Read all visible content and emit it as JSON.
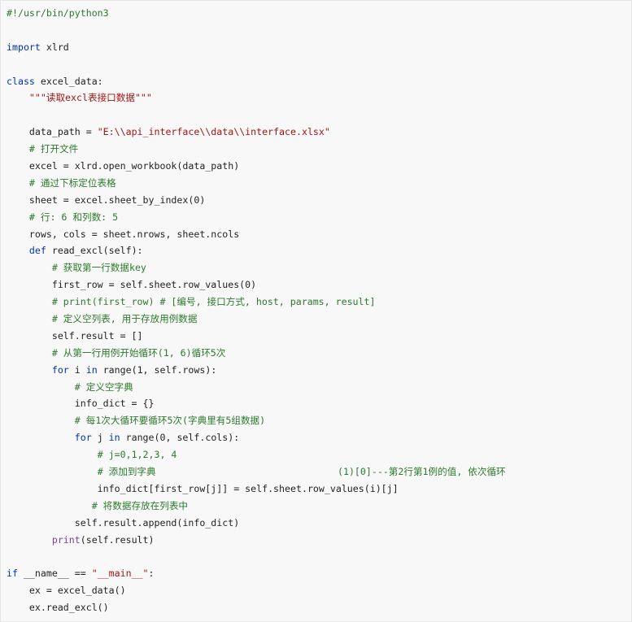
{
  "code_lines": [
    [
      {
        "t": "#!/usr/bin/python3",
        "c": "cm"
      }
    ],
    [],
    [
      {
        "t": "import",
        "c": "kw"
      },
      {
        "t": " xlrd"
      }
    ],
    [],
    [
      {
        "t": "class",
        "c": "kw"
      },
      {
        "t": " excel_data:"
      }
    ],
    [
      {
        "t": "    "
      },
      {
        "t": "\"\"\"读取excl表接口数据\"\"\"",
        "c": "st"
      }
    ],
    [],
    [
      {
        "t": "    data_path = "
      },
      {
        "t": "\"E:\\\\api_interface\\\\data\\\\interface.xlsx\"",
        "c": "st"
      }
    ],
    [
      {
        "t": "    "
      },
      {
        "t": "# 打开文件",
        "c": "cm"
      }
    ],
    [
      {
        "t": "    excel = xlrd.open_workbook(data_path)"
      }
    ],
    [
      {
        "t": "    "
      },
      {
        "t": "# 通过下标定位表格",
        "c": "cm"
      }
    ],
    [
      {
        "t": "    sheet = excel.sheet_by_index(0)"
      }
    ],
    [
      {
        "t": "    "
      },
      {
        "t": "# 行: 6 和列数: 5",
        "c": "cm"
      }
    ],
    [
      {
        "t": "    rows, cols = sheet.nrows, sheet.ncols"
      }
    ],
    [
      {
        "t": "    "
      },
      {
        "t": "def",
        "c": "kw"
      },
      {
        "t": " read_excl(self):"
      }
    ],
    [
      {
        "t": "        "
      },
      {
        "t": "# 获取第一行数据key",
        "c": "cm"
      }
    ],
    [
      {
        "t": "        first_row = self.sheet.row_values(0)"
      }
    ],
    [
      {
        "t": "        "
      },
      {
        "t": "# print(first_row) # [编号, 接口方式, host, params, result]",
        "c": "cm"
      }
    ],
    [
      {
        "t": "        "
      },
      {
        "t": "# 定义空列表, 用于存放用例数据",
        "c": "cm"
      }
    ],
    [
      {
        "t": "        self.result = []"
      }
    ],
    [
      {
        "t": "        "
      },
      {
        "t": "# 从第一行用例开始循环(1, 6)循环5次",
        "c": "cm"
      }
    ],
    [
      {
        "t": "        "
      },
      {
        "t": "for",
        "c": "kw"
      },
      {
        "t": " i "
      },
      {
        "t": "in",
        "c": "kw"
      },
      {
        "t": " range(1, self.rows):"
      }
    ],
    [
      {
        "t": "            "
      },
      {
        "t": "# 定义空字典",
        "c": "cm"
      }
    ],
    [
      {
        "t": "            info_dict = {}"
      }
    ],
    [
      {
        "t": "            "
      },
      {
        "t": "# 每1次大循环要循环5次(字典里有5组数据)",
        "c": "cm"
      }
    ],
    [
      {
        "t": "            "
      },
      {
        "t": "for",
        "c": "kw"
      },
      {
        "t": " j "
      },
      {
        "t": "in",
        "c": "kw"
      },
      {
        "t": " range(0, self.cols):"
      }
    ],
    [
      {
        "t": "                "
      },
      {
        "t": "# j=0,1,2,3, 4",
        "c": "cm"
      }
    ],
    [
      {
        "t": "                "
      },
      {
        "t": "# 添加到字典                                (1)[0]---第2行第1例的值, 依次循环",
        "c": "cm"
      }
    ],
    [
      {
        "t": "                info_dict[first_row[j]] = self.sheet.row_values(i)[j]"
      }
    ],
    [
      {
        "t": "               "
      },
      {
        "t": "# 将数据存放在列表中",
        "c": "cm"
      }
    ],
    [
      {
        "t": "            self.result.append(info_dict)"
      }
    ],
    [
      {
        "t": "        "
      },
      {
        "t": "print",
        "c": "bi"
      },
      {
        "t": "(self.result)"
      }
    ],
    [],
    [
      {
        "t": "if",
        "c": "kw"
      },
      {
        "t": " __name__ == "
      },
      {
        "t": "\"__main__\"",
        "c": "st"
      },
      {
        "t": ":"
      }
    ],
    [
      {
        "t": "    ex = excel_data()"
      }
    ],
    [
      {
        "t": "    ex.read_excl()"
      }
    ]
  ]
}
